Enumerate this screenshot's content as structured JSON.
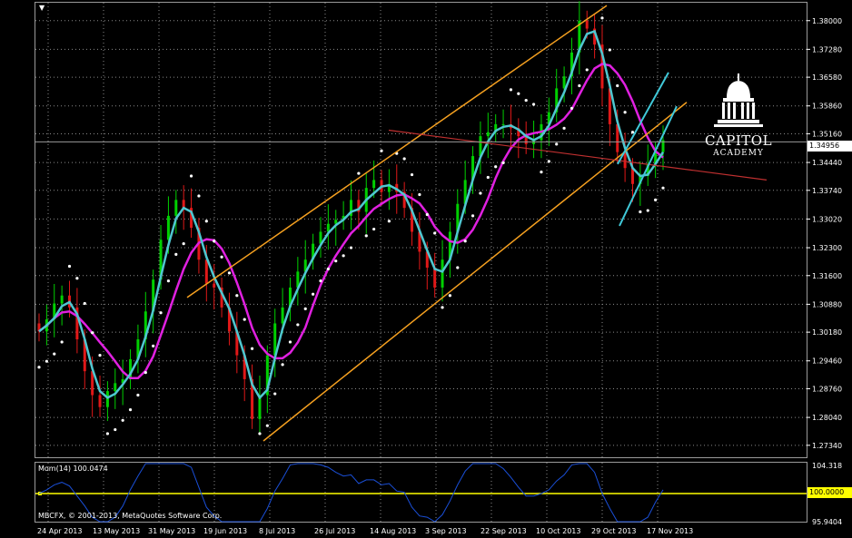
{
  "chart_data": {
    "type": "candlestick",
    "price_axis": {
      "ticks": [
        "1.38000",
        "1.37280",
        "1.36580",
        "1.35860",
        "1.35160",
        "1.34440",
        "1.33740",
        "1.33020",
        "1.32300",
        "1.31600",
        "1.30880",
        "1.30180",
        "1.29460",
        "1.28760",
        "1.28040",
        "1.27340"
      ],
      "range": [
        1.2704,
        1.3845
      ]
    },
    "time_axis": {
      "labels": [
        "24 Apr 2013",
        "13 May 2013",
        "31 May 2013",
        "19 Jun 2013",
        "8 Jul 2013",
        "26 Jul 2013",
        "14 Aug 2013",
        "3 Sep 2013",
        "22 Sep 2013",
        "10 Oct 2013",
        "29 Oct 2013",
        "17 Nov 2013"
      ]
    },
    "current_price": "1.34956",
    "series": [
      {
        "kind": "close",
        "values": [
          1.302,
          1.305,
          1.309,
          1.311,
          1.308,
          1.3,
          1.292,
          1.286,
          1.283,
          1.287,
          1.289,
          1.29,
          1.295,
          1.3,
          1.307,
          1.315,
          1.325,
          1.331,
          1.335,
          1.333,
          1.328,
          1.32,
          1.314,
          1.313,
          1.308,
          1.302,
          1.296,
          1.29,
          1.28,
          1.286,
          1.296,
          1.304,
          1.308,
          1.313,
          1.317,
          1.32,
          1.324,
          1.327,
          1.329,
          1.33,
          1.331,
          1.335,
          1.332,
          1.338,
          1.34,
          1.337,
          1.339,
          1.337,
          1.333,
          1.327,
          1.322,
          1.318,
          1.313,
          1.32,
          1.327,
          1.334,
          1.34,
          1.346,
          1.351,
          1.352,
          1.354,
          1.354,
          1.353,
          1.351,
          1.349,
          1.35,
          1.354,
          1.357,
          1.363,
          1.366,
          1.372,
          1.38,
          1.378,
          1.374,
          1.363,
          1.354,
          1.347,
          1.343,
          1.339,
          1.341,
          1.344,
          1.347,
          1.35
        ]
      },
      {
        "kind": "fast_ma",
        "color": "#4fc7d0"
      },
      {
        "kind": "slow_ma",
        "color": "#e020e0"
      },
      {
        "kind": "parabolic_sar",
        "color": "#ffffff"
      }
    ],
    "momentum": {
      "label": "Mom(14) 100.0474",
      "level": "100.0000",
      "axis_ticks": [
        "104.318",
        "95.9404"
      ],
      "range": [
        95.9404,
        104.318
      ]
    },
    "watermark": "MBCFX, © 2001-2013, MetaQuotes Software Corp.",
    "colors": {
      "up": "#00d000",
      "down": "#e01818",
      "channel": "#f5a020",
      "fast_ma": "#4fc7d0",
      "slow_ma": "#e020e0",
      "momentum": "#1a4fd8",
      "level": "#ffff00",
      "grid": "#8a8a8a",
      "trendline": "#c03030",
      "wedge": "#40c8d8"
    }
  },
  "logo": {
    "title": "CAPITOL",
    "subtitle": "ACADEMY"
  },
  "corner_arrow": "▼"
}
